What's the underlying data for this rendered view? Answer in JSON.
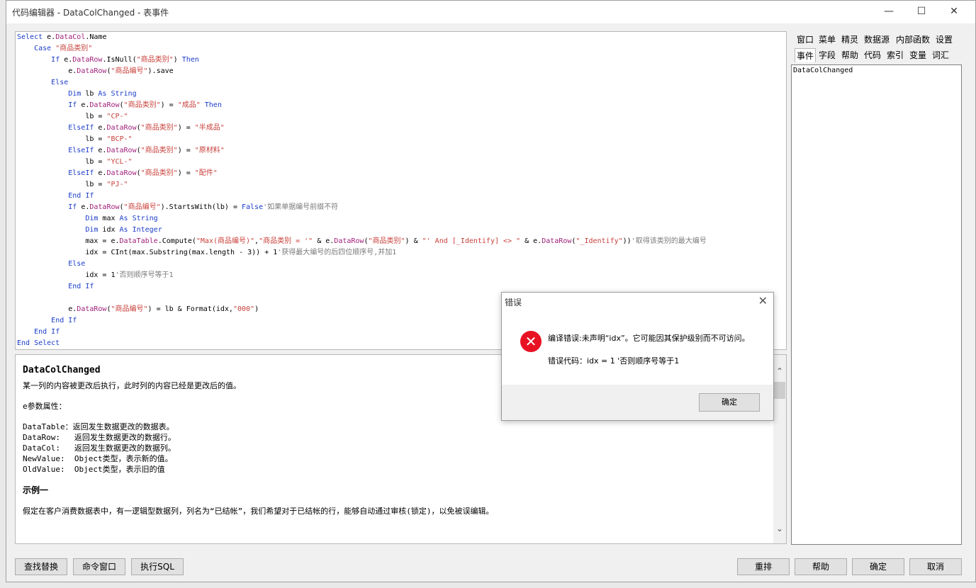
{
  "window": {
    "title": "代码编辑器 - DataColChanged - 表事件"
  },
  "controls": {
    "minimize": "—",
    "maximize": "☐",
    "close": "✕"
  },
  "side_tabs_row1": [
    "窗口",
    "菜单",
    "精灵",
    "数据源",
    "内部函数",
    "设置"
  ],
  "side_tabs_row2": [
    "事件",
    "字段",
    "帮助",
    "代码",
    "索引",
    "变量",
    "词汇"
  ],
  "side_list": {
    "items": [
      "DataColChanged"
    ]
  },
  "code": {
    "lines": [
      [
        [
          "kw",
          "Select "
        ],
        [
          "plain",
          "e."
        ],
        [
          "obj",
          "DataCol"
        ],
        [
          "plain",
          ".Name"
        ]
      ],
      [
        [
          "plain",
          "    "
        ],
        [
          "kw",
          "Case "
        ],
        [
          "str",
          "\"商品类别\""
        ]
      ],
      [
        [
          "plain",
          "        "
        ],
        [
          "kw",
          "If "
        ],
        [
          "plain",
          "e."
        ],
        [
          "obj",
          "DataRow"
        ],
        [
          "plain",
          ".IsNull("
        ],
        [
          "str",
          "\"商品类别\""
        ],
        [
          "plain",
          ") "
        ],
        [
          "kw",
          "Then"
        ]
      ],
      [
        [
          "plain",
          "            e."
        ],
        [
          "obj",
          "DataRow"
        ],
        [
          "plain",
          "("
        ],
        [
          "str",
          "\"商品编号\""
        ],
        [
          "plain",
          ").save"
        ]
      ],
      [
        [
          "plain",
          "        "
        ],
        [
          "kw",
          "Else"
        ]
      ],
      [
        [
          "plain",
          "            "
        ],
        [
          "kw",
          "Dim "
        ],
        [
          "plain",
          "lb "
        ],
        [
          "kw",
          "As String"
        ]
      ],
      [
        [
          "plain",
          "            "
        ],
        [
          "kw",
          "If "
        ],
        [
          "plain",
          "e."
        ],
        [
          "obj",
          "DataRow"
        ],
        [
          "plain",
          "("
        ],
        [
          "str",
          "\"商品类别\""
        ],
        [
          "plain",
          ") = "
        ],
        [
          "str",
          "\"成品\""
        ],
        [
          "plain",
          " "
        ],
        [
          "kw",
          "Then"
        ]
      ],
      [
        [
          "plain",
          "                lb = "
        ],
        [
          "str",
          "\"CP-\""
        ]
      ],
      [
        [
          "plain",
          "            "
        ],
        [
          "kw",
          "ElseIf "
        ],
        [
          "plain",
          "e."
        ],
        [
          "obj",
          "DataRow"
        ],
        [
          "plain",
          "("
        ],
        [
          "str",
          "\"商品类别\""
        ],
        [
          "plain",
          ") = "
        ],
        [
          "str",
          "\"半成品\""
        ]
      ],
      [
        [
          "plain",
          "                lb = "
        ],
        [
          "str",
          "\"BCP-\""
        ]
      ],
      [
        [
          "plain",
          "            "
        ],
        [
          "kw",
          "ElseIf "
        ],
        [
          "plain",
          "e."
        ],
        [
          "obj",
          "DataRow"
        ],
        [
          "plain",
          "("
        ],
        [
          "str",
          "\"商品类别\""
        ],
        [
          "plain",
          ") = "
        ],
        [
          "str",
          "\"原材料\""
        ]
      ],
      [
        [
          "plain",
          "                lb = "
        ],
        [
          "str",
          "\"YCL-\""
        ]
      ],
      [
        [
          "plain",
          "            "
        ],
        [
          "kw",
          "ElseIf "
        ],
        [
          "plain",
          "e."
        ],
        [
          "obj",
          "DataRow"
        ],
        [
          "plain",
          "("
        ],
        [
          "str",
          "\"商品类别\""
        ],
        [
          "plain",
          ") = "
        ],
        [
          "str",
          "\"配件\""
        ]
      ],
      [
        [
          "plain",
          "                lb = "
        ],
        [
          "str",
          "\"PJ-\""
        ]
      ],
      [
        [
          "plain",
          "            "
        ],
        [
          "kw",
          "End If"
        ]
      ],
      [
        [
          "plain",
          "            "
        ],
        [
          "kw",
          "If "
        ],
        [
          "plain",
          "e."
        ],
        [
          "obj",
          "DataRow"
        ],
        [
          "plain",
          "("
        ],
        [
          "str",
          "\"商品编号\""
        ],
        [
          "plain",
          ").StartsWith(lb) = "
        ],
        [
          "kw",
          "False"
        ],
        [
          "cmt",
          "'如果单据编号前缀不符"
        ]
      ],
      [
        [
          "plain",
          "                "
        ],
        [
          "kw",
          "Dim "
        ],
        [
          "plain",
          "max "
        ],
        [
          "kw",
          "As String"
        ]
      ],
      [
        [
          "plain",
          "                "
        ],
        [
          "kw",
          "Dim "
        ],
        [
          "plain",
          "idx "
        ],
        [
          "kw",
          "As Integer"
        ]
      ],
      [
        [
          "plain",
          "                max = e."
        ],
        [
          "obj",
          "DataTable"
        ],
        [
          "plain",
          ".Compute("
        ],
        [
          "str",
          "\"Max(商品编号)\""
        ],
        [
          "plain",
          ","
        ],
        [
          "str",
          "\"商品类别 = '\""
        ],
        [
          "plain",
          " & e."
        ],
        [
          "obj",
          "DataRow"
        ],
        [
          "plain",
          "("
        ],
        [
          "str",
          "\"商品类别\""
        ],
        [
          "plain",
          ") & "
        ],
        [
          "str",
          "\"' And [_Identify] <> \""
        ],
        [
          "plain",
          " & e."
        ],
        [
          "obj",
          "DataRow"
        ],
        [
          "plain",
          "("
        ],
        [
          "str",
          "\"_Identify\""
        ],
        [
          "plain",
          "))"
        ],
        [
          "cmt",
          "'取得该类别的最大编号"
        ]
      ],
      [
        [
          "plain",
          "                idx = CInt(max.Substring(max.length - 3)) + 1"
        ],
        [
          "cmt",
          "'获得最大编号的后四位顺序号,并加1"
        ]
      ],
      [
        [
          "plain",
          "            "
        ],
        [
          "kw",
          "Else"
        ]
      ],
      [
        [
          "plain",
          "                idx = 1"
        ],
        [
          "cmt",
          "'否则顺序号等于1"
        ]
      ],
      [
        [
          "plain",
          "            "
        ],
        [
          "kw",
          "End If"
        ]
      ],
      [
        [
          "plain",
          ""
        ]
      ],
      [
        [
          "plain",
          "            e."
        ],
        [
          "obj",
          "DataRow"
        ],
        [
          "plain",
          "("
        ],
        [
          "str",
          "\"商品编号\""
        ],
        [
          "plain",
          ") = lb & Format(idx,"
        ],
        [
          "str",
          "\"000\""
        ],
        [
          "plain",
          ")"
        ]
      ],
      [
        [
          "plain",
          "        "
        ],
        [
          "kw",
          "End If"
        ]
      ],
      [
        [
          "plain",
          "    "
        ],
        [
          "kw",
          "End If"
        ]
      ],
      [
        [
          "kw",
          "End Select"
        ]
      ]
    ]
  },
  "help": {
    "heading": "DataColChanged",
    "desc": "某一列的内容被更改后执行，此时列的内容已经是更改后的值。",
    "param_title": "e参数属性：",
    "params": [
      "DataTable：返回发生数据更改的数据表。",
      "DataRow:   返回发生数据更改的数据行。",
      "DataCol:   返回发生数据更改的数据列。",
      "NewValue:  Object类型，表示新的值。",
      "OldValue:  Object类型，表示旧的值"
    ],
    "example_title": "示例一",
    "example_text": "假定在客户消费数据表中，有一逻辑型数据列，列名为“已结帐”，我们希望对于已结帐的行，能够自动通过审核(锁定)，以免被误编辑。"
  },
  "buttons": {
    "find_replace": "查找替换",
    "command_window": "命令窗口",
    "exec_sql": "执行SQL",
    "rearrange": "重排",
    "help": "帮助",
    "ok": "确定",
    "cancel": "取消"
  },
  "dialog": {
    "title": "错误",
    "message": "编译错误:未声明“idx”。它可能因其保护级别而不可访问。",
    "code_line": "错误代码：idx = 1 '否则顺序号等于1",
    "ok": "确定"
  }
}
